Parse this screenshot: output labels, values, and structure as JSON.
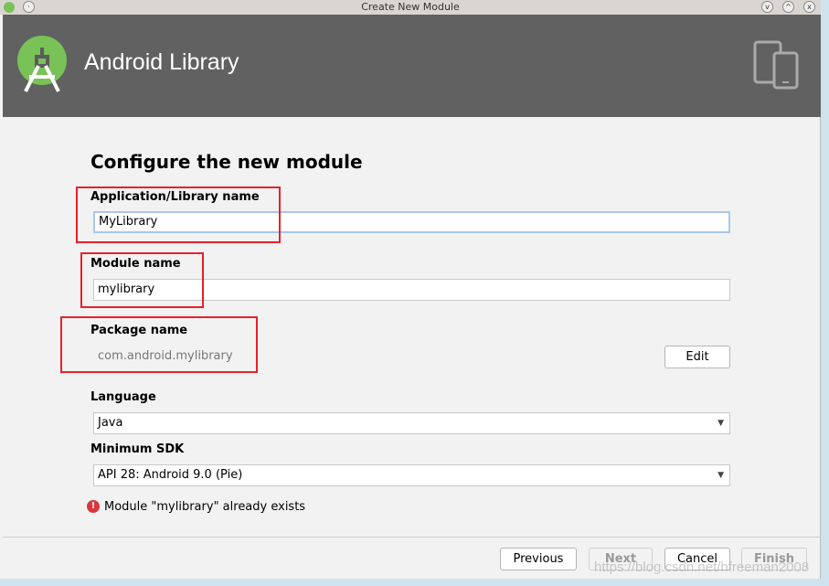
{
  "window": {
    "title": "Create New Module"
  },
  "header": {
    "title": "Android Library"
  },
  "form": {
    "heading": "Configure the new module",
    "app_name_label": "Application/Library name",
    "app_name_value": "MyLibrary",
    "module_name_label": "Module name",
    "module_name_value": "mylibrary",
    "package_label": "Package name",
    "package_value": "com.android.mylibrary",
    "edit_label": "Edit",
    "language_label": "Language",
    "language_value": "Java",
    "min_sdk_label": "Minimum SDK",
    "min_sdk_value": "API 28: Android 9.0 (Pie)",
    "error": "Module \"mylibrary\" already exists"
  },
  "footer": {
    "previous": "Previous",
    "next": "Next",
    "cancel": "Cancel",
    "finish": "Finish"
  },
  "watermark": "https://blog.csdn.net/hfreeman2008",
  "colors": {
    "header": "#616161",
    "android_green": "#78c257",
    "highlight": "#e8202a",
    "error": "#d9363e"
  }
}
